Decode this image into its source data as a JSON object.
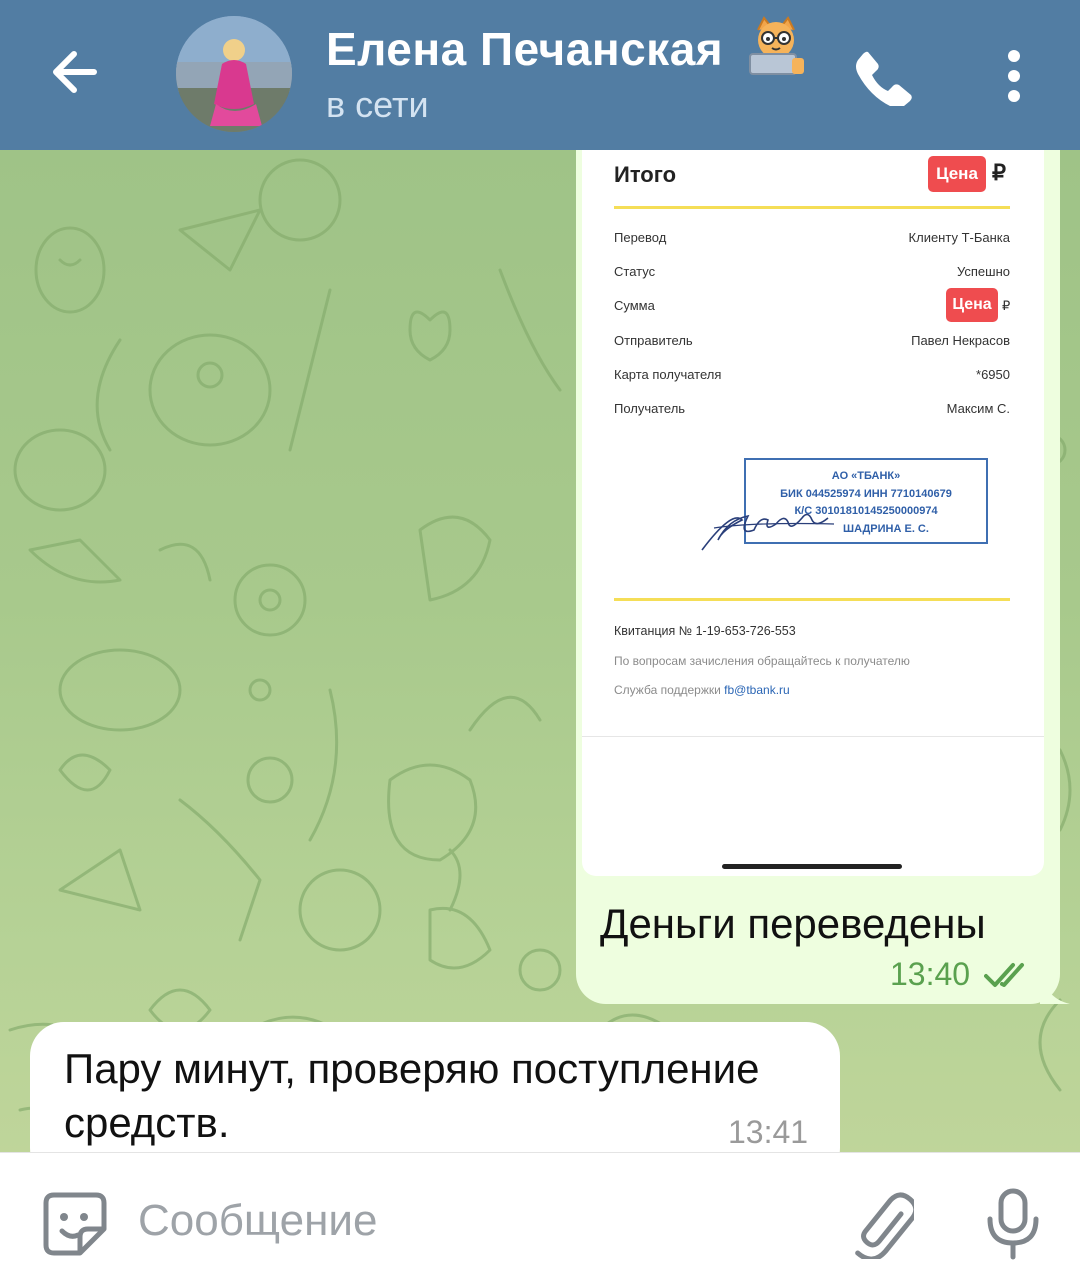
{
  "header": {
    "contact_name": "Елена Печанская",
    "status": "в сети",
    "back_icon": "arrow-left-icon",
    "call_icon": "phone-icon",
    "menu_icon": "more-vertical-icon",
    "status_emoji": "cat-with-laptop"
  },
  "receipt": {
    "total_label": "Итого",
    "price_badge": "Цена",
    "currency": "₽",
    "rows": [
      {
        "label": "Перевод",
        "value": "Клиенту Т-Банка"
      },
      {
        "label": "Статус",
        "value": "Успешно"
      },
      {
        "label": "Сумма",
        "value": ""
      },
      {
        "label": "Отправитель",
        "value": "Павел Некрасов"
      },
      {
        "label": "Карта получателя",
        "value": "*6950"
      },
      {
        "label": "Получатель",
        "value": "Максим С."
      }
    ],
    "amount_badge": "Цена",
    "amount_currency": "₽",
    "stamp": {
      "line1": "АО «ТБАНК»",
      "line2": "БИК 044525974 ИНН 7710140679",
      "line3": "К/С 30101810145250000974",
      "line4": "ШАДРИНА Е. С."
    },
    "receipt_number": "Квитанция  № 1-19-653-726-553",
    "question_text": "По вопросам зачисления обращайтесь к получателю",
    "support_label": "Служба поддержки",
    "support_email": "fb@tbank.ru"
  },
  "messages": {
    "outgoing": {
      "text": "Деньги переведены",
      "time": "13:40",
      "read": true
    },
    "incoming": {
      "text": "Пару минут, проверяю поступление средств.",
      "time": "13:41"
    }
  },
  "input": {
    "placeholder": "Сообщение",
    "sticker_icon": "sticker-smile-icon",
    "attach_icon": "paperclip-icon",
    "mic_icon": "microphone-icon"
  },
  "colors": {
    "header": "#527da3",
    "outgoing_bubble": "#eefedf",
    "price_badge": "#ef4c4f",
    "receipt_accent": "#f5de57",
    "time_outgoing": "#5aa14f",
    "chat_bg": "#a9c98a"
  }
}
